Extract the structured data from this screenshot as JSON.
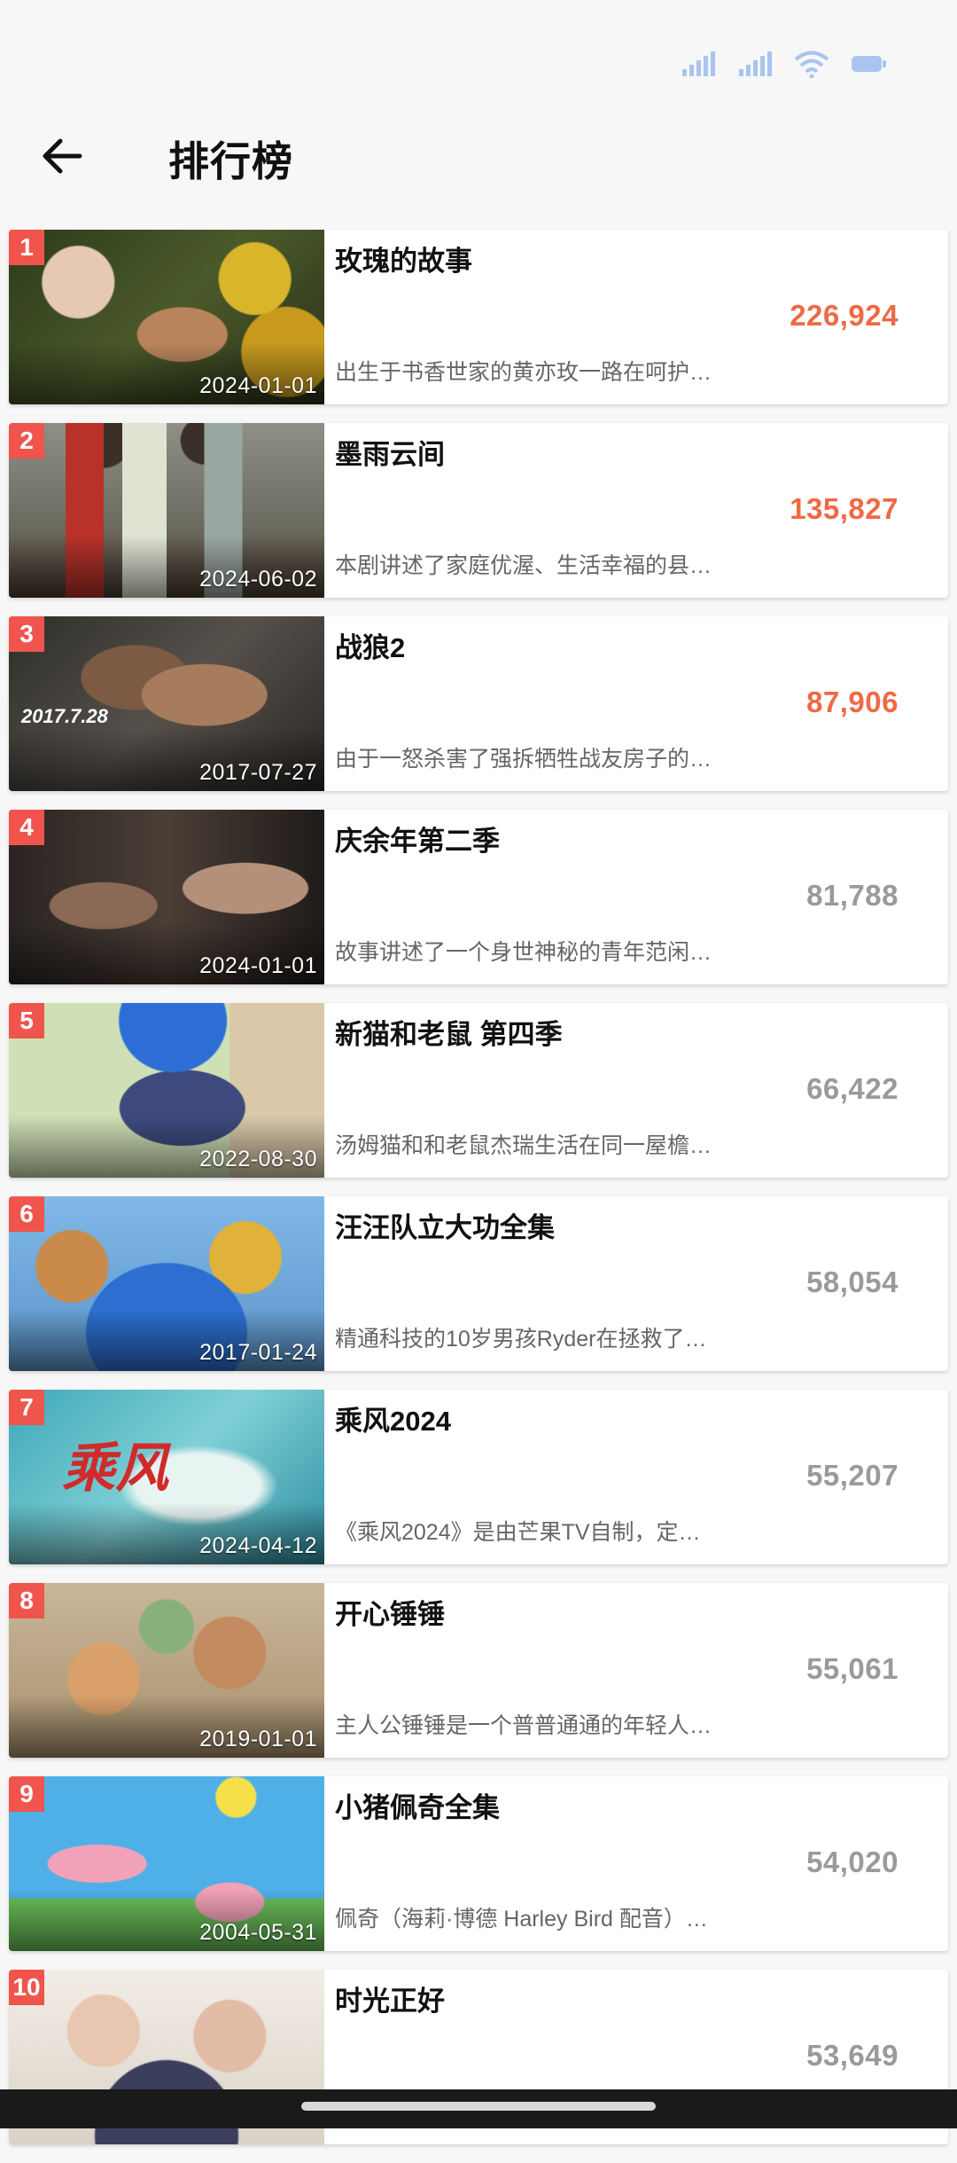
{
  "header": {
    "title": "排行榜"
  },
  "colors": {
    "badge": "#f0554d",
    "hot_count": "#ee6a45",
    "normal_count": "#9a9a9a"
  },
  "icons": {
    "back": "arrow-left-icon",
    "signal": "signal-icon",
    "wifi": "wifi-icon",
    "battery": "battery-icon"
  },
  "items": [
    {
      "rank": "1",
      "title": "玫瑰的故事",
      "count": "226,924",
      "date": "2024-01-01",
      "desc": "出生于书香世家的黄亦玫一路在呵护…",
      "hot": true
    },
    {
      "rank": "2",
      "title": "墨雨云间",
      "count": "135,827",
      "date": "2024-06-02",
      "desc": "本剧讲述了家庭优渥、生活幸福的县…",
      "hot": true
    },
    {
      "rank": "3",
      "title": "战狼2",
      "count": "87,906",
      "date": "2017-07-27",
      "desc": "由于一怒杀害了强拆牺牲战友房子的…",
      "hot": true
    },
    {
      "rank": "4",
      "title": "庆余年第二季",
      "count": "81,788",
      "date": "2024-01-01",
      "desc": "故事讲述了一个身世神秘的青年范闲…",
      "hot": false
    },
    {
      "rank": "5",
      "title": "新猫和老鼠 第四季",
      "count": "66,422",
      "date": "2022-08-30",
      "desc": "汤姆猫和和老鼠杰瑞生活在同一屋檐…",
      "hot": false
    },
    {
      "rank": "6",
      "title": "汪汪队立大功全集",
      "count": "58,054",
      "date": "2017-01-24",
      "desc": "精通科技的10岁男孩Ryder在拯救了…",
      "hot": false
    },
    {
      "rank": "7",
      "title": "乘风2024",
      "count": "55,207",
      "date": "2024-04-12",
      "desc": "《乘风2024》是由芒果TV自制，定…",
      "hot": false
    },
    {
      "rank": "8",
      "title": "开心锤锤",
      "count": "55,061",
      "date": "2019-01-01",
      "desc": "主人公锤锤是一个普普通通的年轻人…",
      "hot": false
    },
    {
      "rank": "9",
      "title": "小猪佩奇全集",
      "count": "54,020",
      "date": "2004-05-31",
      "desc": "佩奇（海莉·博德 Harley Bird 配音）…",
      "hot": false
    },
    {
      "rank": "10",
      "title": "时光正好",
      "count": "53,649",
      "date": "",
      "desc": "",
      "hot": false
    }
  ]
}
